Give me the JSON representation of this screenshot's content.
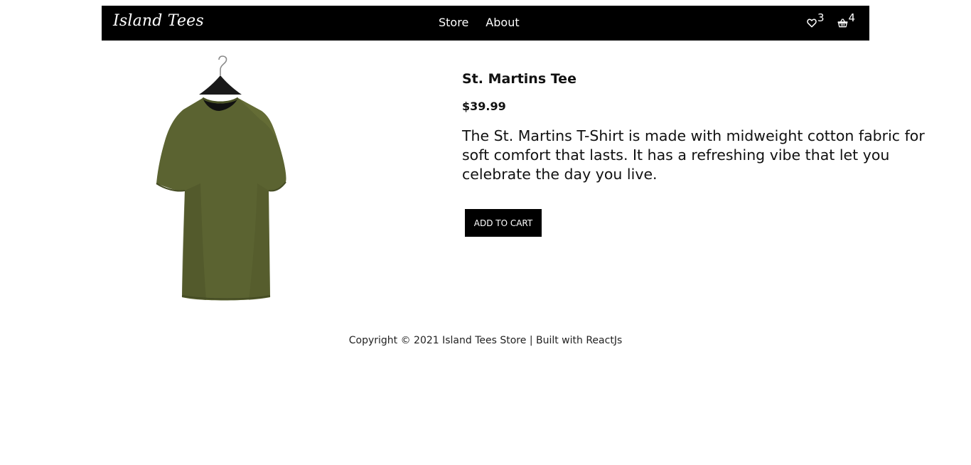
{
  "navbar": {
    "brand": "Island Tees",
    "links": [
      {
        "label": "Store"
      },
      {
        "label": "About"
      }
    ],
    "wishlist": {
      "icon": "heart-icon",
      "count": "3"
    },
    "cart": {
      "icon": "basket-icon",
      "count": "4"
    },
    "background": "#000000"
  },
  "product": {
    "name": "St. Martins Tee",
    "price": "$39.99",
    "description": "The St. Martins T-Shirt is made with midweight cotton fabric for soft comfort that lasts. It has a refreshing vibe that let you celebrate the day you live.",
    "image": {
      "icon": "olive-tshirt-on-hanger",
      "color": "#5b6331"
    },
    "add_to_cart_label": "ADD TO CART"
  },
  "footer": {
    "text": "Copyright © 2021 Island Tees Store | Built with ReactJs"
  }
}
